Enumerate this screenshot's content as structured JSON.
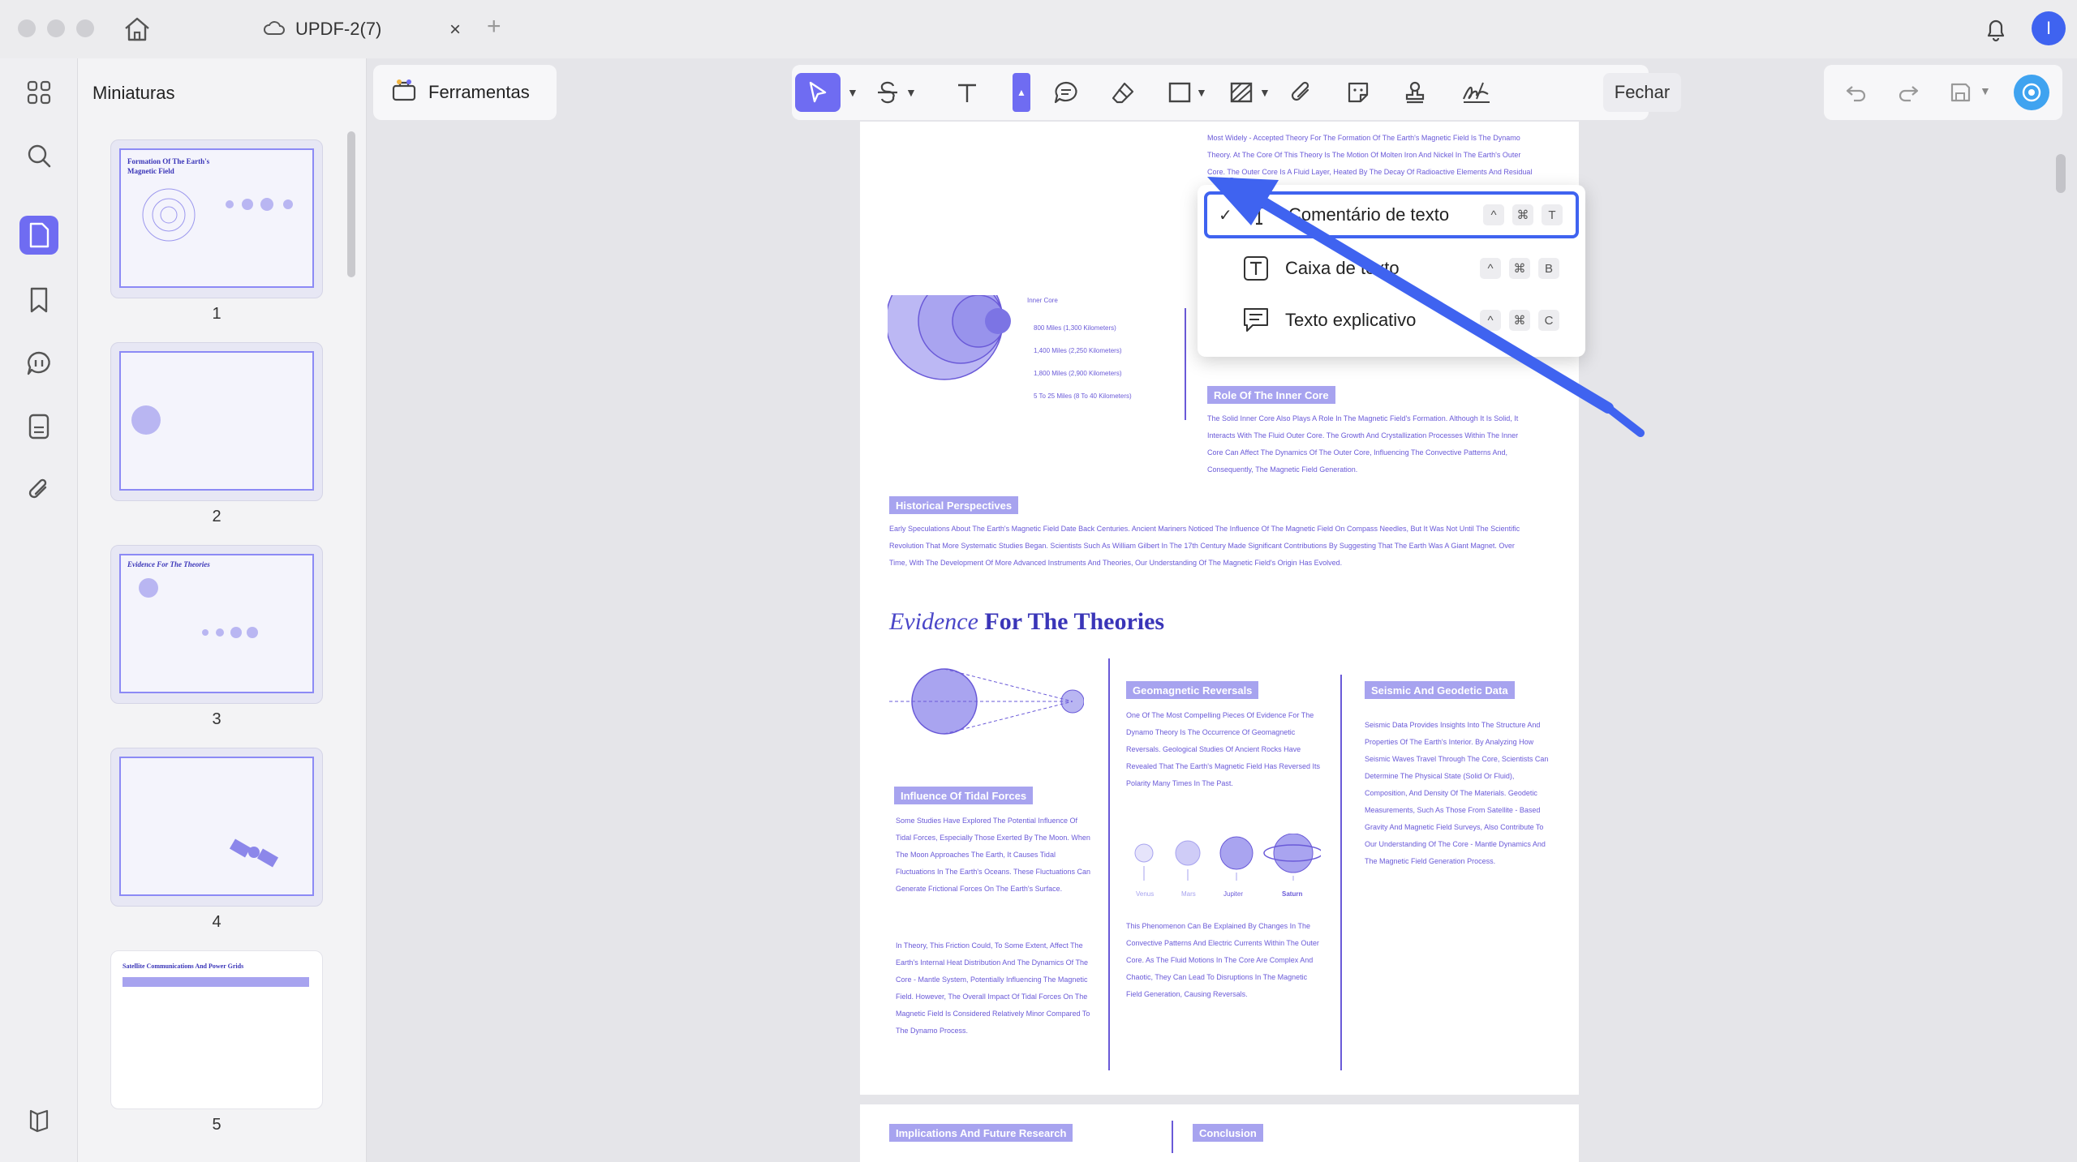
{
  "window": {
    "tab_title": "UPDF-2(7)",
    "tab_close": "×",
    "tab_add": "+",
    "avatar_initial": "I"
  },
  "sidebar": {
    "panel_title": "Miniaturas",
    "rail_icons": [
      "grid-icon",
      "search-icon",
      "thumbnails-icon",
      "bookmark-icon",
      "comment-icon",
      "form-icon",
      "attachment-icon",
      "layers-icon"
    ],
    "thumbnails": [
      {
        "number": "1",
        "title": "Formation Of The Earth's Magnetic Field"
      },
      {
        "number": "2",
        "title": ""
      },
      {
        "number": "3",
        "title": "Evidence For The Theories"
      },
      {
        "number": "4",
        "title": ""
      },
      {
        "number": "5",
        "title": "Satellite Communications And Power Grids"
      }
    ]
  },
  "toolbar": {
    "tools_label": "Ferramentas",
    "close_label": "Fechar"
  },
  "dropdown": {
    "items": [
      {
        "label": "Comentário de texto",
        "checked": "✓",
        "keys": [
          "^",
          "⌘",
          "T"
        ]
      },
      {
        "label": "Caixa de texto",
        "checked": "",
        "keys": [
          "^",
          "⌘",
          "B"
        ]
      },
      {
        "label": "Texto explicativo",
        "checked": "",
        "keys": [
          "^",
          "⌘",
          "C"
        ]
      }
    ]
  },
  "document": {
    "top_page": {
      "paragraph_1": "Most Widely - Accepted Theory For The Formation Of The Earth's Magnetic Field Is The Dynamo Theory. At The Core Of This Theory Is The Motion Of Molten Iron And Nickel In The Earth's Outer Core. The Outer Core Is A Fluid Layer, Heated By The Decay Of Radioactive Elements And Residual Heat From The Planet's Formation. The Heat Creates Convection Currents Within The Fluid. The Coriolis Force Acts On These Convective Flows, Organizing Them Into Patterns That Generate Electric Currents. According To Ampere's Law, Electric Currents Produce Magnetic Fields. The Combination Of Convection And Rotation In The Outer Core Creates A Self - Sustaining Process That Generates The Earth's Magnetic Field.",
      "diagram_labels": [
        "Inner Core",
        "800 Miles (1,300 Kilometers)",
        "1,400 Miles (2,250 Kilometers)",
        "1,800 Miles (2,900 Kilometers)",
        "5 To 25 Miles (8 To 40 Kilometers)"
      ],
      "inner_core_heading": "Role Of The Inner Core",
      "inner_core_text": "The Solid Inner Core Also Plays A Role In The Magnetic Field's Formation. Although It Is Solid, It Interacts With The Fluid Outer Core. The Growth And Crystallization Processes Within The Inner Core Can Affect The Dynamics Of The Outer Core, Influencing The Convective Patterns And, Consequently, The Magnetic Field Generation.",
      "historical_heading": "Historical Perspectives",
      "historical_text": "Early Speculations About The Earth's Magnetic Field Date Back Centuries. Ancient Mariners Noticed The Influence Of The Magnetic Field On Compass Needles, But It Was Not Until The Scientific Revolution That More Systematic Studies Began. Scientists Such As William Gilbert In The 17th Century Made Significant Contributions By Suggesting That The Earth Was A Giant Magnet. Over Time, With The Development Of More Advanced Instruments And Theories, Our Understanding Of The Magnetic Field's Origin Has Evolved."
    },
    "mid_page": {
      "title_italic": "Evidence",
      "title_rest": " For The Theories",
      "tidal_heading": "Influence Of Tidal Forces",
      "tidal_text_1": "Some Studies Have Explored The Potential Influence Of Tidal Forces, Especially Those Exerted By The Moon. When The Moon Approaches The Earth, It Causes Tidal Fluctuations In The Earth's Oceans. These Fluctuations Can Generate Frictional Forces On The Earth's Surface.",
      "tidal_text_2": "In Theory, This Friction Could, To Some Extent, Affect The Earth's Internal Heat Distribution And The Dynamics Of The Core - Mantle System, Potentially Influencing The Magnetic Field. However, The Overall Impact Of Tidal Forces On The Magnetic Field Is Considered Relatively Minor Compared To The Dynamo Process.",
      "geo_heading": "Geomagnetic Reversals",
      "geo_text_1": "One Of The Most Compelling Pieces Of Evidence For The Dynamo Theory Is The Occurrence Of Geomagnetic Reversals. Geological Studies Of Ancient Rocks Have Revealed That The Earth's Magnetic Field Has Reversed Its Polarity Many Times In The Past.",
      "planets": [
        "Venus",
        "Mars",
        "Jupiter",
        "Saturn"
      ],
      "geo_text_2": "This Phenomenon Can Be Explained By Changes In The Convective Patterns And Electric Currents Within The Outer Core. As The Fluid Motions In The Core Are Complex And Chaotic, They Can Lead To Disruptions In The Magnetic Field Generation, Causing Reversals.",
      "seismic_heading": "Seismic And Geodetic Data",
      "seismic_text": "Seismic Data Provides Insights Into The Structure And Properties Of The Earth's Interior. By Analyzing How Seismic Waves Travel Through The Core, Scientists Can Determine The Physical State (Solid Or Fluid), Composition, And Density Of The Materials. Geodetic Measurements, Such As Those From Satellite - Based Gravity And Magnetic Field Surveys, Also Contribute To Our Understanding Of The Core - Mantle Dynamics And The Magnetic Field Generation Process."
    },
    "bottom_page": {
      "heading_left": "Implications And Future Research",
      "heading_right": "Conclusion"
    }
  },
  "colors": {
    "accent": "#6f6cf2",
    "selection": "#3f63f0",
    "doc_text": "#6a5ad8",
    "doc_tag": "#a7a3ef"
  }
}
